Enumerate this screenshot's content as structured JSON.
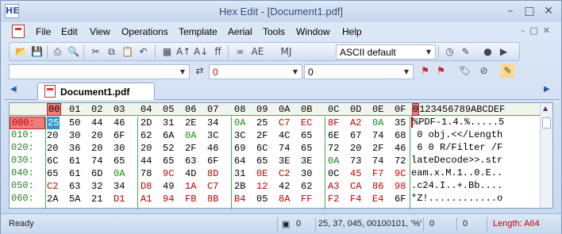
{
  "window": {
    "title": "Hex Edit - [Document1.pdf]",
    "app_icon": "HE"
  },
  "menu": {
    "items": [
      {
        "label": "File"
      },
      {
        "label": "Edit"
      },
      {
        "label": "View"
      },
      {
        "label": "Operations"
      },
      {
        "label": "Template"
      },
      {
        "label": "Aerial"
      },
      {
        "label": "Tools"
      },
      {
        "label": "Window"
      },
      {
        "label": "Help"
      }
    ]
  },
  "toolbar": {
    "charset_select": "ASCII default"
  },
  "addressbar": {
    "combo1": "",
    "combo2": "0",
    "combo3": "0"
  },
  "tab": {
    "label": "Document1.pdf"
  },
  "grid": {
    "headers": [
      "00",
      "01",
      "02",
      "03",
      "04",
      "05",
      "06",
      "07",
      "08",
      "09",
      "0A",
      "0B",
      "0C",
      "0D",
      "0E",
      "0F"
    ],
    "ascii_header": "0123456789ABCDEF",
    "addresses": [
      "000:",
      "010:",
      "020:",
      "030:",
      "040:",
      "050:",
      "060:"
    ],
    "rows": [
      [
        "25",
        "50",
        "44",
        "46",
        "2D",
        "31",
        "2E",
        "34",
        "0A",
        "25",
        "C7",
        "EC",
        "8F",
        "A2",
        "0A",
        "35"
      ],
      [
        "20",
        "30",
        "20",
        "6F",
        "62",
        "6A",
        "0A",
        "3C",
        "3C",
        "2F",
        "4C",
        "65",
        "6E",
        "67",
        "74",
        "68"
      ],
      [
        "20",
        "36",
        "20",
        "30",
        "20",
        "52",
        "2F",
        "46",
        "69",
        "6C",
        "74",
        "65",
        "72",
        "20",
        "2F",
        "46"
      ],
      [
        "6C",
        "61",
        "74",
        "65",
        "44",
        "65",
        "63",
        "6F",
        "64",
        "65",
        "3E",
        "3E",
        "0A",
        "73",
        "74",
        "72"
      ],
      [
        "65",
        "61",
        "6D",
        "0A",
        "78",
        "9C",
        "4D",
        "8D",
        "31",
        "0E",
        "C2",
        "30",
        "0C",
        "45",
        "F7",
        "9C"
      ],
      [
        "C2",
        "63",
        "32",
        "34",
        "D8",
        "49",
        "1A",
        "C7",
        "2B",
        "12",
        "42",
        "62",
        "A3",
        "CA",
        "86",
        "98"
      ],
      [
        "2A",
        "5A",
        "21",
        "D1",
        "A1",
        "94",
        "FB",
        "8B",
        "B4",
        "05",
        "8A",
        "FF",
        "F2",
        "F4",
        "E4",
        "6F"
      ]
    ],
    "ascii_rows": [
      "%PDF-1.4.%.....5",
      " 0 obj.<</Length",
      " 6 0 R/Filter /F",
      "lateDecode>>.str",
      "eam.x.M.1..0.E..",
      ".c24.I..+.Bb....",
      "*Z!............o"
    ]
  },
  "status": {
    "ready": "Ready",
    "mark_value": "0",
    "cursor_info": "25, 37, 045, 00100101, '%'",
    "offset_a": "0",
    "offset_b": "0",
    "length": "Length: A64"
  }
}
